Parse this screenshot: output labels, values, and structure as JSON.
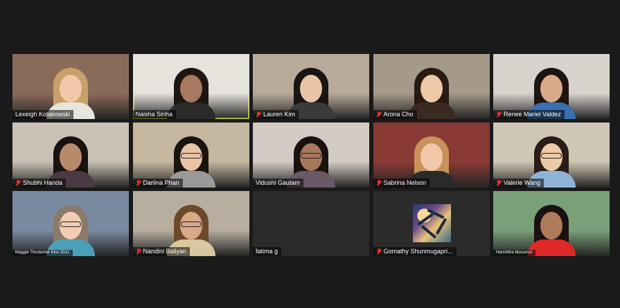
{
  "meeting": {
    "participants": [
      {
        "name": "Lexeigh Kolakowski",
        "muted": false,
        "active": false,
        "bg": "#8a6b5a",
        "hair": "#c9a06a",
        "skin": "#f1c9a8",
        "shirt": "#e8e4de"
      },
      {
        "name": "Naisha Sinha",
        "muted": false,
        "active": true,
        "bg": "#e6e2dc",
        "hair": "#1e1612",
        "skin": "#a87860",
        "shirt": "#2b2b2b"
      },
      {
        "name": "Lauren Kim",
        "muted": true,
        "active": false,
        "bg": "#b9ab9a",
        "hair": "#1a1412",
        "skin": "#e8c5a6",
        "shirt": "#3a3a3a"
      },
      {
        "name": "Arona Cho",
        "muted": true,
        "active": false,
        "bg": "#a59a88",
        "hair": "#2a1a14",
        "skin": "#efc8a8",
        "shirt": "#3a2a22"
      },
      {
        "name": "Renee Mariel Valdez",
        "muted": true,
        "active": false,
        "bg": "#d8d3cc",
        "hair": "#1c1410",
        "skin": "#d9a98a",
        "shirt": "#3a6fb0"
      },
      {
        "name": "Shubhi Handa",
        "muted": true,
        "active": false,
        "bg": "#c9c1b6",
        "hair": "#1a120e",
        "skin": "#b88a6c",
        "shirt": "#4a3a44"
      },
      {
        "name": "Darlina Phan",
        "muted": true,
        "active": false,
        "bg": "#c6b8a0",
        "hair": "#1a1410",
        "skin": "#e8c4a4",
        "shirt": "#9a9a9a",
        "glasses": true
      },
      {
        "name": "Vidushi Gautam",
        "muted": false,
        "active": false,
        "bg": "#d2cbc3",
        "hair": "#1a1210",
        "skin": "#a8785c",
        "shirt": "#6a5a66",
        "glasses": true
      },
      {
        "name": "Sabrina Nelson",
        "muted": true,
        "active": false,
        "bg": "#8a3a34",
        "hair": "#c7935a",
        "skin": "#f2c8aa",
        "shirt": "#2a2a2a"
      },
      {
        "name": "Valerie Wang",
        "muted": true,
        "active": false,
        "bg": "#cfc6b6",
        "hair": "#2a1c16",
        "skin": "#eccaa8",
        "shirt": "#8fb4d8",
        "glasses": true
      },
      {
        "name": "Maggie Thorlacher Kins 2011",
        "muted": false,
        "active": false,
        "small": true,
        "bg": "#7a8aa0",
        "hair": "#8a7a6a",
        "skin": "#f0cdb4",
        "shirt": "#4aa0b8",
        "glasses": true
      },
      {
        "name": "Nandini Baliyan",
        "muted": true,
        "active": false,
        "bg": "#b8aea0",
        "hair": "#6a4a2a",
        "skin": "#d8a888",
        "shirt": "#d9c7a0",
        "glasses": true
      },
      {
        "name": "fatima g",
        "muted": false,
        "active": false,
        "noVideo": true
      },
      {
        "name": "Gomathy Shunmugapri...",
        "muted": true,
        "active": false,
        "noVideo": true,
        "avatar": "palm-photo"
      },
      {
        "name": "Harshitha Musunuri",
        "muted": false,
        "active": false,
        "small": true,
        "bg": "#7aa07a",
        "hair": "#1a1210",
        "skin": "#b07a5c",
        "shirt": "#e02828"
      }
    ]
  }
}
